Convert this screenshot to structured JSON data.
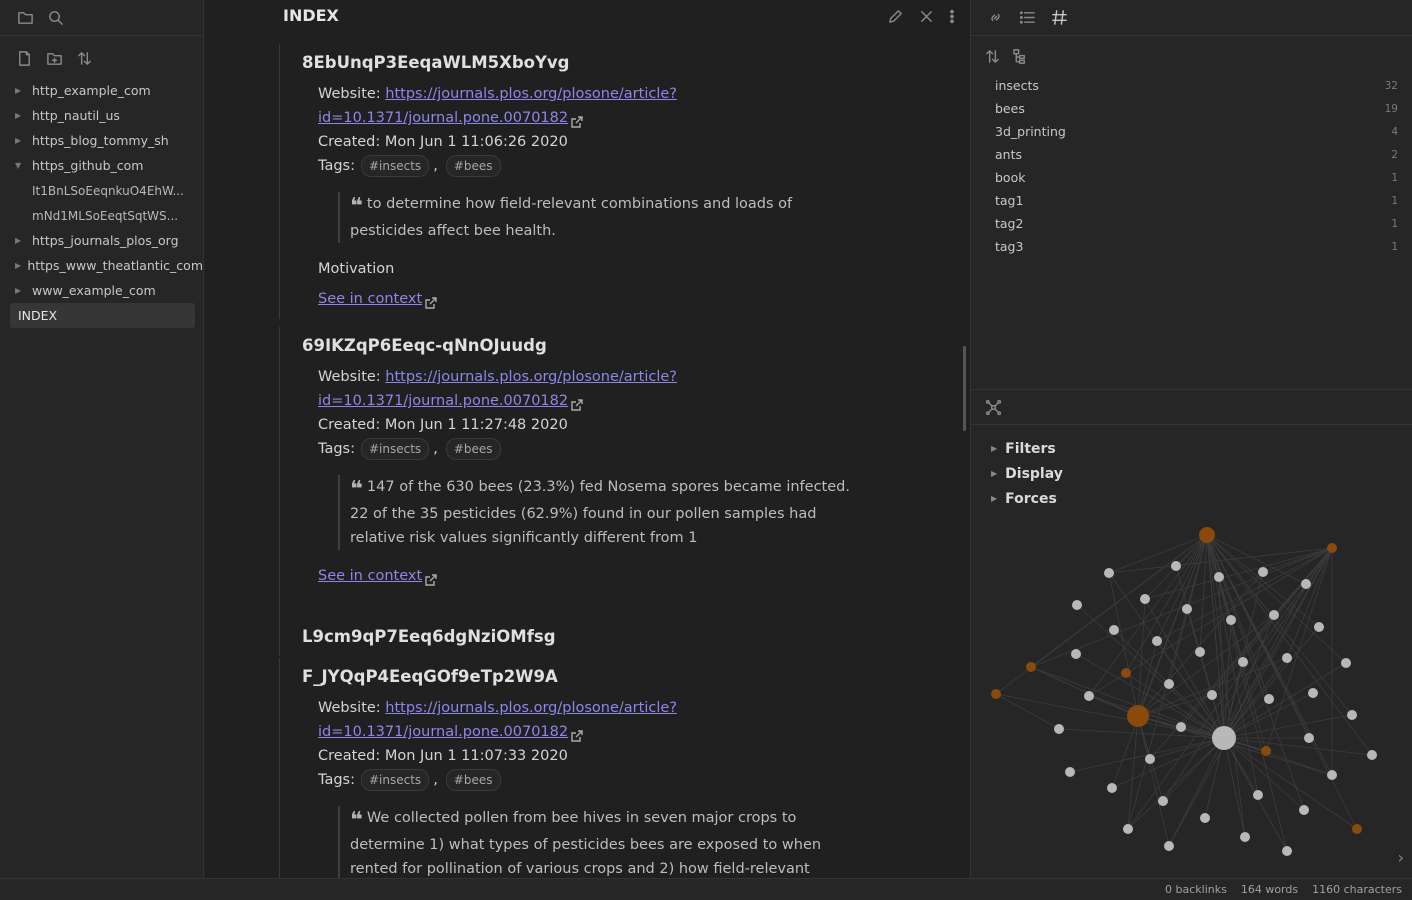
{
  "left_sidebar": {
    "tree": [
      {
        "label": "http_example_com",
        "type": "folder",
        "expanded": false
      },
      {
        "label": "http_nautil_us",
        "type": "folder",
        "expanded": false
      },
      {
        "label": "https_blog_tommy_sh",
        "type": "folder",
        "expanded": false
      },
      {
        "label": "https_github_com",
        "type": "folder",
        "expanded": true
      },
      {
        "label": "It1BnLSoEeqnkuO4EhW...",
        "type": "child"
      },
      {
        "label": "mNd1MLSoEeqtSqtWS...",
        "type": "child"
      },
      {
        "label": "https_journals_plos_org",
        "type": "folder",
        "expanded": false
      },
      {
        "label": "https_www_theatlantic_com",
        "type": "folder",
        "expanded": false
      },
      {
        "label": "www_example_com",
        "type": "folder",
        "expanded": false
      },
      {
        "label": "INDEX",
        "type": "file",
        "active": true
      }
    ]
  },
  "main": {
    "title": "INDEX",
    "entries": [
      {
        "heading": "8EbUnqP3EeqaWLM5XboYvg",
        "website_label": "Website:",
        "url_line1": "https://journals.plos.org/plosone/article?",
        "url_line2": "id=10.1371/journal.pone.0070182",
        "created": "Created: Mon Jun 1 11:06:26 2020",
        "tags_label": "Tags:",
        "tags": [
          "#insects",
          "#bees"
        ],
        "quote": "to determine how field-relevant combinations and loads of pesticides affect bee health.",
        "note": "Motivation",
        "see_context": "See in context"
      },
      {
        "heading": "69IKZqP6Eeqc-qNnOJuudg",
        "website_label": "Website:",
        "url_line1": "https://journals.plos.org/plosone/article?",
        "url_line2": "id=10.1371/journal.pone.0070182",
        "created": "Created: Mon Jun 1 11:27:48 2020",
        "tags_label": "Tags:",
        "tags": [
          "#insects",
          "#bees"
        ],
        "quote": "147 of the 630 bees (23.3%) fed Nosema spores became infected. 22 of the 35 pesticides (62.9%) found in our pollen samples had relative risk values significantly different from 1",
        "see_context": "See in context"
      },
      {
        "heading": "L9cm9qP7Eeq6dgNziOMfsg"
      },
      {
        "heading": "F_JYQqP4EeqGOf9eTp2W9A",
        "website_label": "Website:",
        "url_line1": "https://journals.plos.org/plosone/article?",
        "url_line2": "id=10.1371/journal.pone.0070182",
        "created": "Created: Mon Jun 1 11:07:33 2020",
        "tags_label": "Tags:",
        "tags": [
          "#insects",
          "#bees"
        ],
        "quote": "We collected pollen from bee hives in seven major crops to determine 1) what types of pesticides bees are exposed to when rented for pollination of various crops and 2) how field-relevant"
      }
    ]
  },
  "right_sidebar": {
    "tags": [
      {
        "name": "insects",
        "count": "32"
      },
      {
        "name": "bees",
        "count": "19"
      },
      {
        "name": "3d_printing",
        "count": "4"
      },
      {
        "name": "ants",
        "count": "2"
      },
      {
        "name": "book",
        "count": "1"
      },
      {
        "name": "tag1",
        "count": "1"
      },
      {
        "name": "tag2",
        "count": "1"
      },
      {
        "name": "tag3",
        "count": "1"
      }
    ],
    "graph_controls": [
      "Filters",
      "Display",
      "Forces"
    ],
    "colors": {
      "node": "#b8b8b8",
      "tag_node": "#8a4a0c",
      "edge": "#3c3c3c"
    }
  },
  "status_bar": {
    "backlinks": "0 backlinks",
    "words": "164 words",
    "characters": "1160 characters"
  }
}
